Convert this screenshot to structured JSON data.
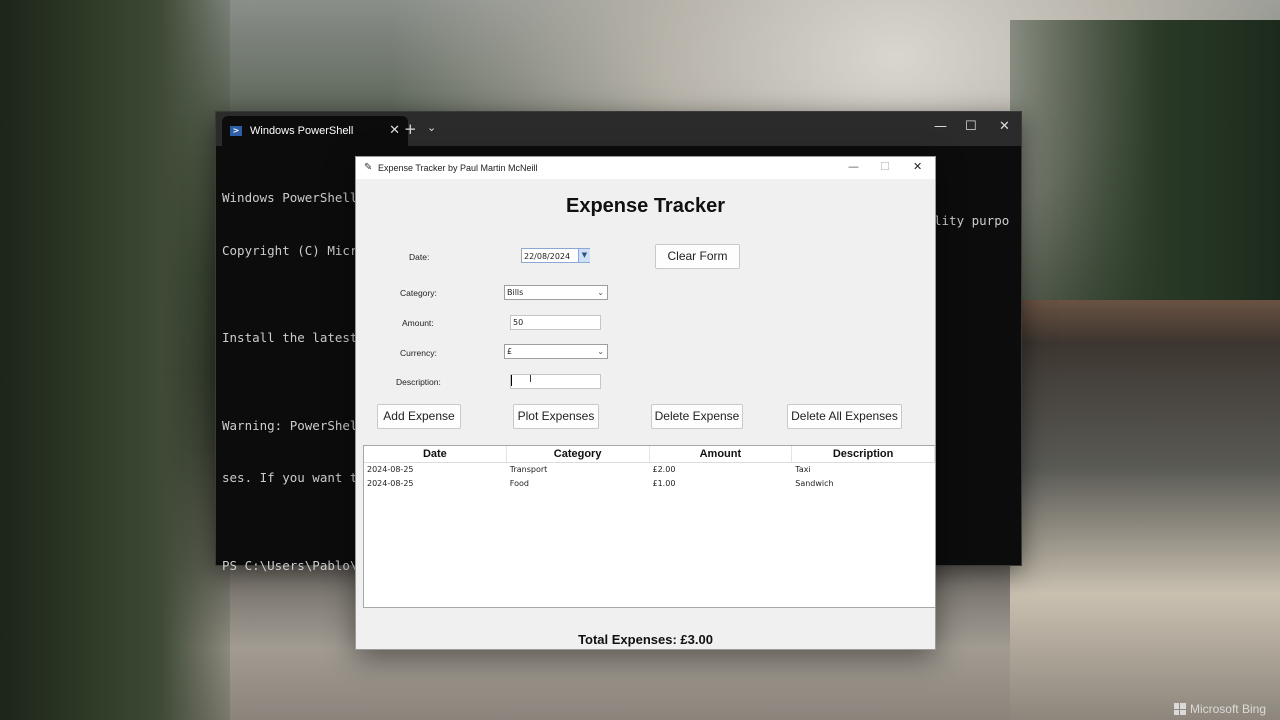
{
  "desktop": {
    "watermark": "Microsoft Bing"
  },
  "terminal": {
    "tab_title": "Windows PowerShell",
    "lines": [
      "Windows PowerShell",
      "Copyright (C) Microso",
      "",
      "Install the latest Po",
      "",
      "Warning: PowerShell d",
      "ses. If you want to r",
      "",
      "PS C:\\Users\\Pablo\\Doc"
    ],
    "right_fragment_1": "lity purpo"
  },
  "app": {
    "window_title": "Expense Tracker by Paul Martin McNeill",
    "heading": "Expense Tracker",
    "form": {
      "date_label": "Date:",
      "date_value": "22/08/2024",
      "category_label": "Category:",
      "category_value": "Bills",
      "amount_label": "Amount:",
      "amount_value": "50",
      "currency_label": "Currency:",
      "currency_value": "£",
      "description_label": "Description:",
      "description_value": ""
    },
    "buttons": {
      "clear_form": "Clear Form",
      "add_expense": "Add Expense",
      "plot_expenses": "Plot Expenses",
      "delete_expense": "Delete Expense",
      "delete_all": "Delete All Expenses"
    },
    "table": {
      "headers": [
        "Date",
        "Category",
        "Amount",
        "Description"
      ],
      "rows": [
        [
          "2024-08-25",
          "Transport",
          "£2.00",
          "Taxi"
        ],
        [
          "2024-08-25",
          "Food",
          "£1.00",
          "Sandwich"
        ]
      ]
    },
    "total": "Total Expenses: £3.00"
  }
}
